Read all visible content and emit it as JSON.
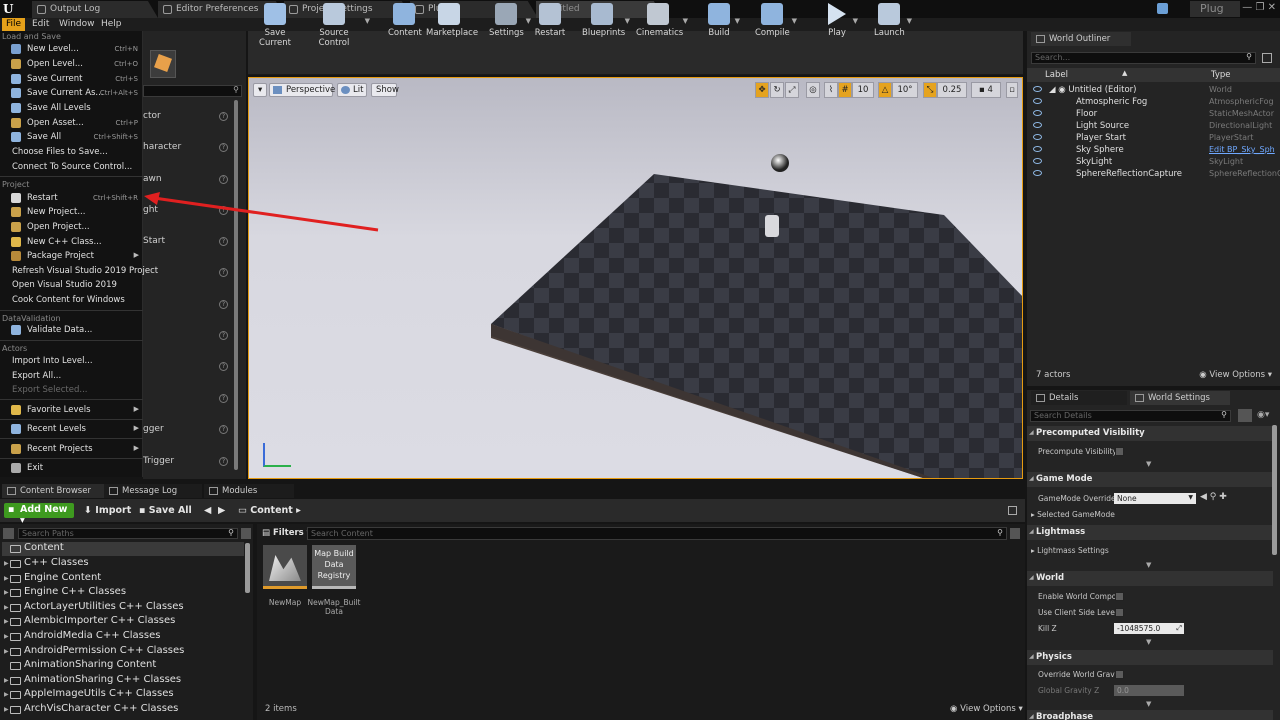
{
  "tabs": [
    "Output Log",
    "Editor Preferences",
    "Project Settings",
    "Plugins",
    "Untitled"
  ],
  "plug_label": "Plug",
  "menu": [
    "File",
    "Edit",
    "Window",
    "Help"
  ],
  "file_menu": {
    "load_and_save": {
      "header": "Load and Save",
      "items": [
        {
          "label": "New Level...",
          "shortcut": "Ctrl+N"
        },
        {
          "label": "Open Level...",
          "shortcut": "Ctrl+O"
        },
        {
          "label": "Save Current",
          "shortcut": "Ctrl+S"
        },
        {
          "label": "Save Current As...",
          "shortcut": "Ctrl+Alt+S"
        },
        {
          "label": "Save All Levels",
          "shortcut": ""
        },
        {
          "label": "Open Asset...",
          "shortcut": "Ctrl+P"
        },
        {
          "label": "Save All",
          "shortcut": "Ctrl+Shift+S"
        },
        {
          "label": "Choose Files to Save...",
          "shortcut": ""
        },
        {
          "label": "Connect To Source Control...",
          "shortcut": ""
        }
      ]
    },
    "project": {
      "header": "Project",
      "items": [
        {
          "label": "Restart",
          "shortcut": "Ctrl+Shift+R"
        },
        {
          "label": "New Project...",
          "shortcut": ""
        },
        {
          "label": "Open Project...",
          "shortcut": ""
        },
        {
          "label": "New C++ Class...",
          "shortcut": ""
        },
        {
          "label": "Package Project",
          "shortcut": ""
        },
        {
          "label": "Refresh Visual Studio 2019 Project",
          "shortcut": ""
        },
        {
          "label": "Open Visual Studio 2019",
          "shortcut": ""
        },
        {
          "label": "Cook Content for Windows",
          "shortcut": ""
        }
      ]
    },
    "datavalidation": {
      "header": "DataValidation",
      "items": [
        {
          "label": "Validate Data...",
          "shortcut": ""
        }
      ]
    },
    "actors": {
      "header": "Actors",
      "items": [
        {
          "label": "Import Into Level...",
          "shortcut": ""
        },
        {
          "label": "Export All...",
          "shortcut": ""
        },
        {
          "label": "Export Selected...",
          "shortcut": ""
        }
      ]
    },
    "favorite_levels": "Favorite Levels",
    "recent_levels": "Recent Levels",
    "recent_projects": "Recent Projects",
    "exit": "Exit"
  },
  "place_items_partial": [
    "ctor",
    "haracter",
    "awn",
    "ght",
    "Start",
    "gger",
    "Trigger"
  ],
  "toolbar": [
    "Save Current",
    "Source Control",
    "Content",
    "Marketplace",
    "Settings",
    "Restart",
    "Blueprints",
    "Cinematics",
    "Build",
    "Compile",
    "Play",
    "Launch"
  ],
  "viewport": {
    "perspective": "Perspective",
    "lit": "Lit",
    "show": "Show",
    "grid_snap": "10",
    "rot_snap": "10°",
    "scale_snap": "0.25",
    "cam_speed": "4"
  },
  "outliner": {
    "tab": "World Outliner",
    "search_placeholder": "Search...",
    "col_label": "Label",
    "col_type": "Type",
    "rows": [
      {
        "label": "Untitled (Editor)",
        "type": "World"
      },
      {
        "label": "Atmospheric Fog",
        "type": "AtmosphericFog"
      },
      {
        "label": "Floor",
        "type": "StaticMeshActor"
      },
      {
        "label": "Light Source",
        "type": "DirectionalLight"
      },
      {
        "label": "Player Start",
        "type": "PlayerStart"
      },
      {
        "label": "Sky Sphere",
        "type": "Edit BP_Sky_Sph"
      },
      {
        "label": "SkyLight",
        "type": "SkyLight"
      },
      {
        "label": "SphereReflectionCapture",
        "type": "SphereReflectionC"
      }
    ],
    "actor_count": "7 actors",
    "view_options": "View Options"
  },
  "details": {
    "tab_details": "Details",
    "tab_world_settings": "World Settings",
    "search_placeholder": "Search Details",
    "categories": {
      "precomputed_visibility": "Precomputed Visibility",
      "game_mode": "Game Mode",
      "lightmass": "Lightmass",
      "world": "World",
      "physics": "Physics",
      "broadphase": "Broadphase"
    },
    "props": {
      "precompute_visibility": "Precompute Visibility",
      "gamemode_override": "GameMode Override",
      "gamemode_value": "None",
      "selected_gamemode": "Selected GameMode",
      "lightmass_settings": "Lightmass Settings",
      "enable_world_composition": "Enable World Composi",
      "use_client_side_level": "Use Client Side Level",
      "kill_z": "Kill Z",
      "kill_z_value": "-1048575.0",
      "override_world_gravity": "Override World Gravity",
      "global_gravity_z": "Global Gravity Z",
      "global_gravity_value": "0.0"
    }
  },
  "bottom_tabs": [
    "Content Browser",
    "Message Log",
    "Modules"
  ],
  "content_browser": {
    "add_new": "Add New",
    "import": "Import",
    "save_all": "Save All",
    "path": "Content",
    "paths_search_placeholder": "Search Paths",
    "filters": "Filters",
    "content_search_placeholder": "Search Content",
    "folders": [
      "Content",
      "C++ Classes",
      "Engine Content",
      "Engine C++ Classes",
      "ActorLayerUtilities C++ Classes",
      "AlembicImporter C++ Classes",
      "AndroidMedia C++ Classes",
      "AndroidPermission C++ Classes",
      "AnimationSharing Content",
      "AnimationSharing C++ Classes",
      "AppleImageUtils C++ Classes",
      "ArchVisCharacter C++ Classes"
    ],
    "assets": [
      {
        "label": "NewMap",
        "thumb_text": ""
      },
      {
        "label": "NewMap_Built Data",
        "thumb_text": "Map Build Data Registry"
      }
    ],
    "item_count": "2 items",
    "view_options": "View Options"
  },
  "colors": {
    "accent_orange": "#e69b11",
    "add_new_green": "#3e9a1f",
    "annotation_red": "#e02020",
    "link_blue": "#6fa8ff"
  }
}
